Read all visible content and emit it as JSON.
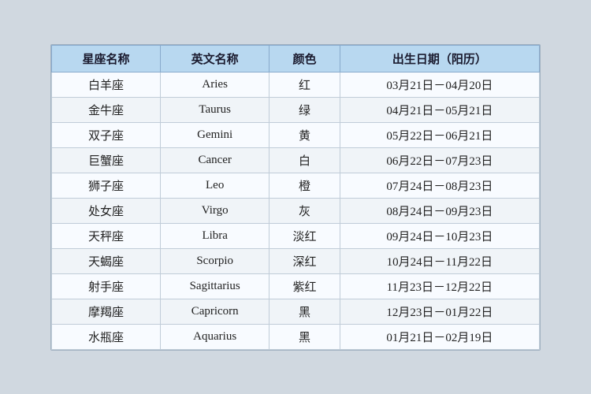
{
  "table": {
    "headers": [
      "星座名称",
      "英文名称",
      "颜色",
      "出生日期（阳历）"
    ],
    "rows": [
      [
        "白羊座",
        "Aries",
        "红",
        "03月21日－04月20日"
      ],
      [
        "金牛座",
        "Taurus",
        "绿",
        "04月21日－05月21日"
      ],
      [
        "双子座",
        "Gemini",
        "黄",
        "05月22日－06月21日"
      ],
      [
        "巨蟹座",
        "Cancer",
        "白",
        "06月22日－07月23日"
      ],
      [
        "狮子座",
        "Leo",
        "橙",
        "07月24日－08月23日"
      ],
      [
        "处女座",
        "Virgo",
        "灰",
        "08月24日－09月23日"
      ],
      [
        "天秤座",
        "Libra",
        "淡红",
        "09月24日－10月23日"
      ],
      [
        "天蝎座",
        "Scorpio",
        "深红",
        "10月24日－11月22日"
      ],
      [
        "射手座",
        "Sagittarius",
        "紫红",
        "11月23日－12月22日"
      ],
      [
        "摩羯座",
        "Capricorn",
        "黑",
        "12月23日－01月22日"
      ],
      [
        "水瓶座",
        "Aquarius",
        "黑",
        "01月21日－02月19日"
      ]
    ]
  }
}
